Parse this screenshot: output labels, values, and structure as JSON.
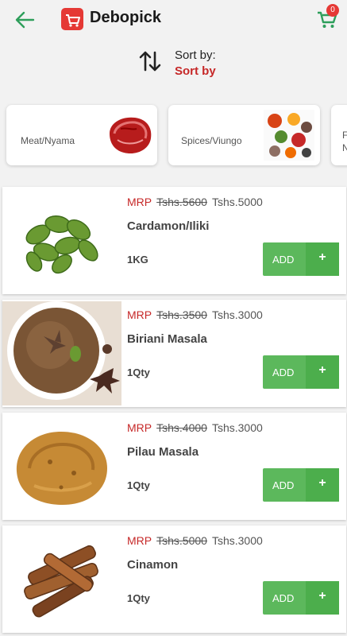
{
  "header": {
    "title": "Debopick",
    "cart_count": "0"
  },
  "sort": {
    "label": "Sort by:",
    "value": "Sort by"
  },
  "categories": [
    {
      "label": "Meat/Nyama"
    },
    {
      "label": "Spices/Viungo"
    },
    {
      "label": "F\nN"
    }
  ],
  "products": [
    {
      "mrp": "MRP",
      "old_price": "Tshs.5600",
      "price": "Tshs.5000",
      "name": "Cardamon/Iliki",
      "qty": "1KG",
      "add": "ADD",
      "plus": "+"
    },
    {
      "mrp": "MRP",
      "old_price": "Tshs.3500",
      "price": "Tshs.3000",
      "name": "Biriani Masala",
      "qty": "1Qty",
      "add": "ADD",
      "plus": "+"
    },
    {
      "mrp": "MRP",
      "old_price": "Tshs.4000",
      "price": "Tshs.3000",
      "name": "Pilau Masala",
      "qty": "1Qty",
      "add": "ADD",
      "plus": "+"
    },
    {
      "mrp": "MRP",
      "old_price": "Tshs.5000",
      "price": "Tshs.3000",
      "name": "Cinamon",
      "qty": "1Qty",
      "add": "ADD",
      "plus": "+"
    }
  ],
  "colors": {
    "accent": "#5cb85c",
    "brand_red": "#e53935",
    "price_red": "#c62828"
  }
}
